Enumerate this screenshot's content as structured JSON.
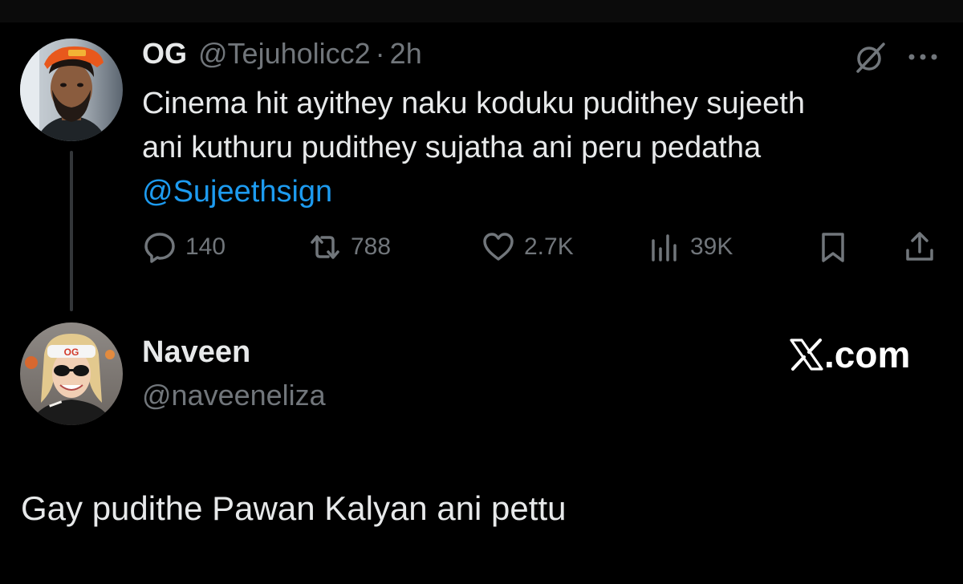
{
  "parent_tweet": {
    "display_name": "OG",
    "handle": "@Tejuholicc2",
    "separator": "·",
    "time": "2h",
    "text_lines": [
      "Cinema hit ayithey naku koduku pudithey sujeeth",
      "ani kuthuru pudithey sujatha ani peru pedatha"
    ],
    "mention": "@Sujeethsign",
    "stats": {
      "replies": "140",
      "reposts": "788",
      "likes": "2.7K",
      "views": "39K"
    }
  },
  "reply": {
    "display_name": "Naveen",
    "handle": "@naveeneliza",
    "text": "Gay pudithe Pawan Kalyan ani pettu"
  },
  "brand": {
    "label": ".com"
  },
  "colors": {
    "background": "#000000",
    "text_primary": "#e7e9ea",
    "text_secondary": "#71767b",
    "link": "#1d9bf0",
    "thread_line": "#333639"
  },
  "icons": {
    "grok": "grok-slash-icon",
    "more": "more-dots-icon",
    "reply": "reply-bubble-icon",
    "repost": "repost-arrows-icon",
    "like": "heart-icon",
    "views": "views-bars-icon",
    "bookmark": "bookmark-icon",
    "share": "share-upload-icon",
    "brand_logo": "x-logo-icon"
  }
}
